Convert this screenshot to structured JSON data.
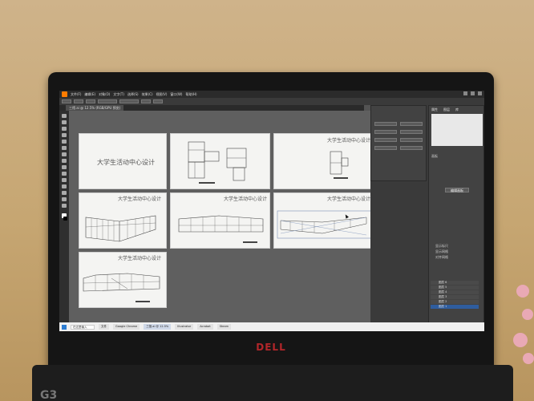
{
  "app": {
    "menu_items": [
      "文件(F)",
      "编辑(E)",
      "对象(O)",
      "文字(T)",
      "选择(S)",
      "效果(C)",
      "视图(V)",
      "窗口(W)",
      "帮助(H)"
    ],
    "document_tab": "三馆.ai @ 12.5% (RGB/GPU 预览)"
  },
  "artboards": [
    {
      "title": "大学生活动中心设计",
      "subtitle": "",
      "kind": "title",
      "big": true
    },
    {
      "title": "",
      "subtitle": "",
      "kind": "plan"
    },
    {
      "title": "大学生活动中心设计",
      "subtitle": "",
      "kind": "plan2"
    },
    {
      "title": "大学生活动中心设计",
      "subtitle": "",
      "kind": "perspective1"
    },
    {
      "title": "大学生活动中心设计",
      "subtitle": "",
      "kind": "elevation1"
    },
    {
      "title": "大学生活动中心设计",
      "subtitle": "",
      "kind": "perspective2"
    },
    {
      "title": "大学生活动中心设计",
      "subtitle": "",
      "kind": "elevation2"
    }
  ],
  "properties_panel": {
    "tabs": [
      "属性",
      "图层",
      "库"
    ],
    "section_label": "画板",
    "button_label": "编辑画板",
    "checkbox_labels": [
      "显示标尺",
      "显示网格",
      "对齐网格"
    ]
  },
  "layers": [
    {
      "name": "图层 6"
    },
    {
      "name": "图层 5"
    },
    {
      "name": "图层 4"
    },
    {
      "name": "图层 3"
    },
    {
      "name": "图层 2"
    },
    {
      "name": "图层 1",
      "active": true
    }
  ],
  "taskbar": {
    "search_placeholder": "在这里输入",
    "apps": [
      {
        "label": "文件"
      },
      {
        "label": "Google Chrome",
        "active": false
      },
      {
        "label": "三馆.ai @ 12.5%",
        "active": true
      },
      {
        "label": "Illustrator"
      },
      {
        "label": "Acrobat"
      },
      {
        "label": "Steam"
      }
    ],
    "time": "",
    "date": ""
  },
  "laptop": {
    "brand": "DELL",
    "base_label": "G3"
  },
  "colors": {
    "app_accent": "#ff7c00",
    "layer_selected": "#2f5d9e",
    "brand_red": "#b3262a"
  }
}
